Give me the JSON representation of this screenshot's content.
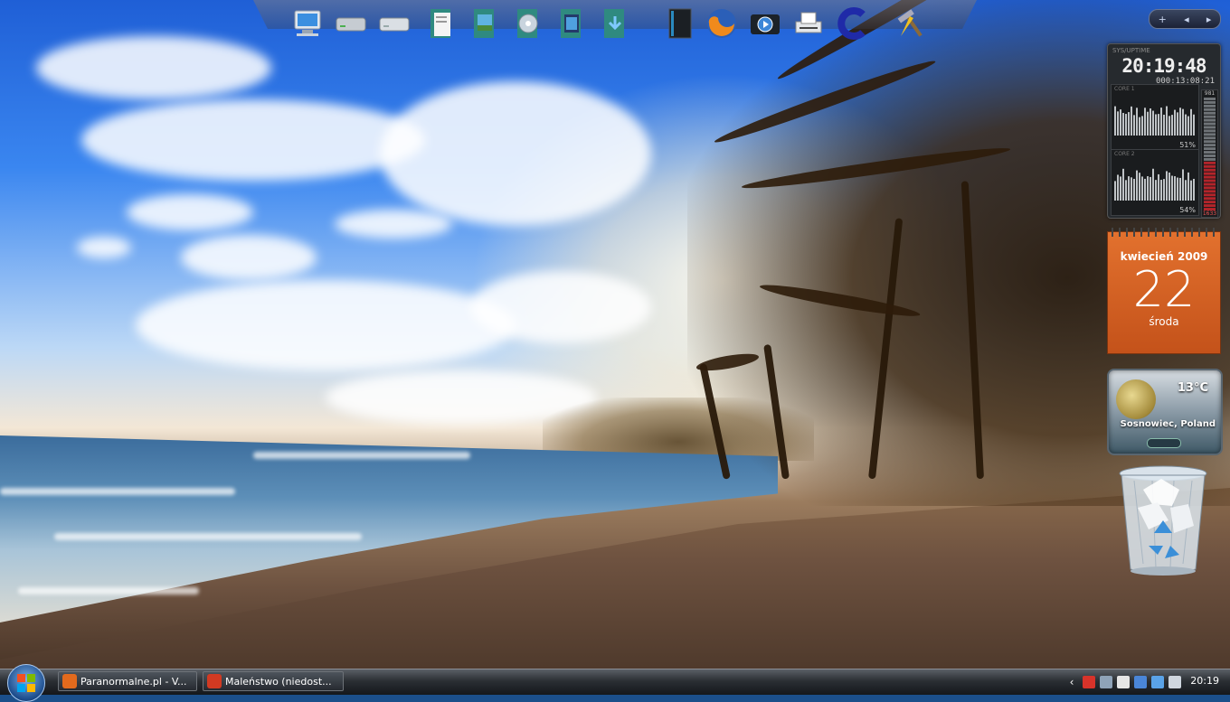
{
  "desktop": {
    "dock_icons": [
      {
        "name": "computer-icon"
      },
      {
        "name": "hard-drive-icon"
      },
      {
        "name": "hard-drive-2-icon"
      },
      {
        "name": "documents-folder-icon"
      },
      {
        "name": "pictures-folder-icon"
      },
      {
        "name": "music-folder-icon"
      },
      {
        "name": "videos-folder-icon"
      },
      {
        "name": "downloads-folder-icon"
      },
      {
        "name": "black-box-icon"
      },
      {
        "name": "firefox-icon"
      },
      {
        "name": "camera-media-icon"
      },
      {
        "name": "printer-icon"
      },
      {
        "name": "ccleaner-icon"
      },
      {
        "name": "tools-icon"
      }
    ]
  },
  "sidebar": {
    "controls": {
      "add": "+",
      "prev": "◂",
      "next": "▸"
    },
    "system_monitor": {
      "header": "SYS/UPTIME",
      "time": "20:19:48",
      "uptime": "000:13:08:21",
      "core1": {
        "label": "CORE 1",
        "percent": "51%",
        "usage": 0.51
      },
      "core2": {
        "label": "CORE 2",
        "percent": "54%",
        "usage": 0.54
      },
      "ram_top": "981",
      "ram_bottom": "1633",
      "ram_fill": 0.45
    },
    "calendar": {
      "month": "kwiecień 2009",
      "day": "22",
      "weekday": "środa"
    },
    "weather": {
      "temperature": "13°C",
      "location": "Sosnowiec, Poland"
    }
  },
  "taskbar": {
    "tasks": [
      {
        "label": "Paranormalne.pl - V...",
        "icon": "firefox-icon",
        "color": "#e36a1d"
      },
      {
        "label": "Maleństwo (niedost...",
        "icon": "gadu-gadu-icon",
        "color": "#d23a22"
      }
    ],
    "tray_icons": [
      {
        "name": "show-hidden-icon",
        "color": "#ffffff"
      },
      {
        "name": "antivirus-icon",
        "color": "#d8332a"
      },
      {
        "name": "network-activity-icon",
        "color": "#8fa3b8"
      },
      {
        "name": "message-icon",
        "color": "#e6e6e6"
      },
      {
        "name": "app-a-icon",
        "color": "#4a86d8"
      },
      {
        "name": "network-icon",
        "color": "#5aa3e8"
      },
      {
        "name": "volume-icon",
        "color": "#cfd6df"
      }
    ],
    "clock": "20:19"
  }
}
